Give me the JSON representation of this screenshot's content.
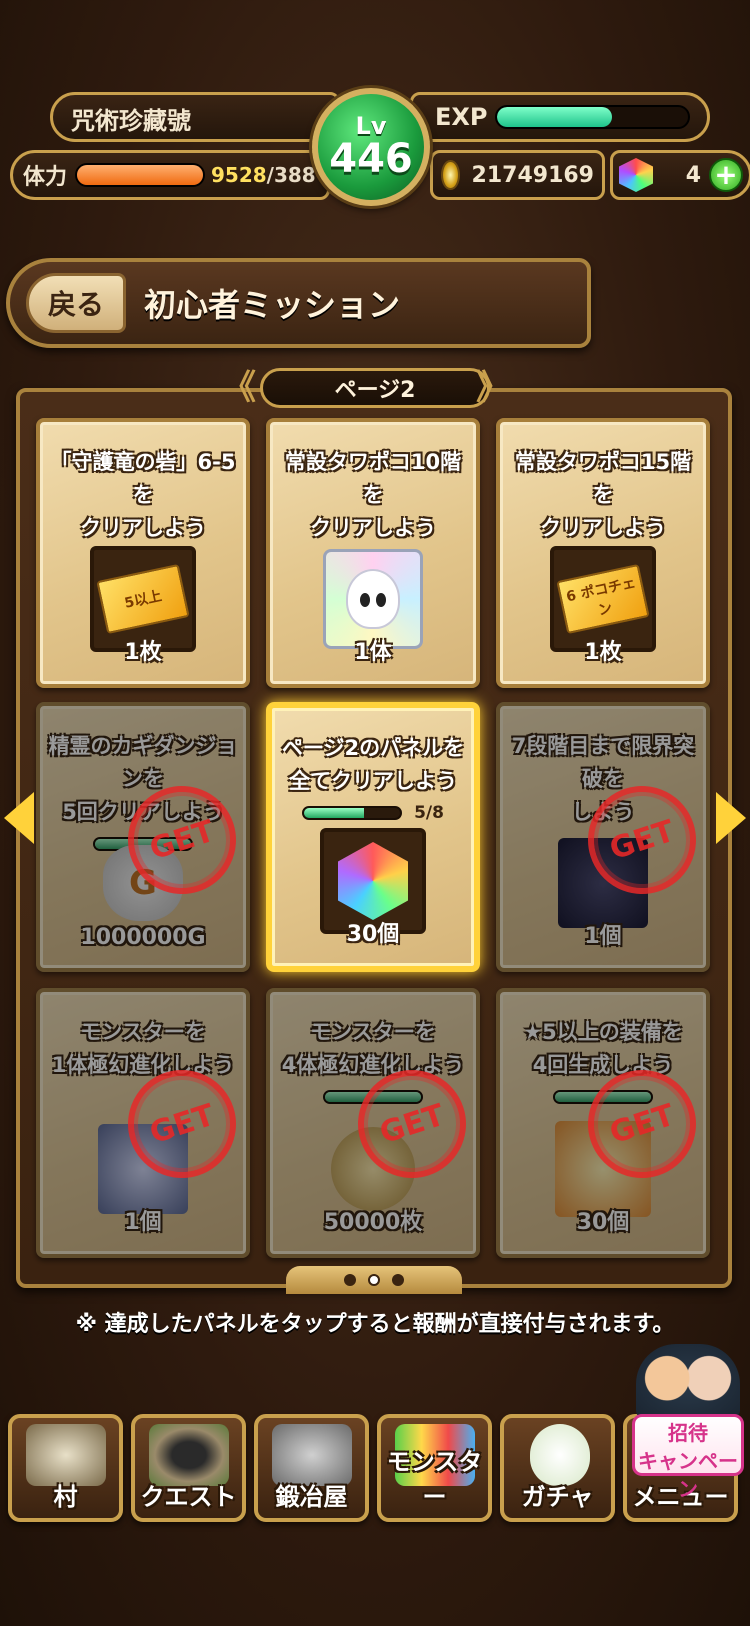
{
  "status": {
    "player_name": "咒術珍藏號",
    "level_label": "Lv",
    "level": "446",
    "exp_label": "EXP",
    "exp_progress": 0.6,
    "stamina_label": "体力",
    "stamina_current": "9528",
    "stamina_max": "/388",
    "stamina_progress": 1.0,
    "gold": "21749169",
    "orbs": "4",
    "plus_label": "+"
  },
  "header": {
    "back_label": "戻る",
    "title": "初心者ミッション"
  },
  "board": {
    "page_label": "ページ2",
    "panels": [
      {
        "title": "「守護竜の砦」6-5を\nクリアしよう",
        "reward_count": "1枚",
        "ticket_text": "5以上"
      },
      {
        "title": "常設タワポコ10階を\nクリアしよう",
        "reward_count": "1体"
      },
      {
        "title": "常設タワポコ15階を\nクリアしよう",
        "reward_count": "1枚",
        "ticket_text": "6 ポコチェン"
      },
      {
        "title": "精霊のカギダンジョンを\n5回クリアしよう",
        "reward_count": "1000000G",
        "bag_text": "G"
      },
      {
        "title": "ページ2のパネルを\n全てクリアしよう",
        "reward_count": "30個",
        "progress_text": "5/8",
        "progress": 0.625
      },
      {
        "title": "7段階目まで限界突破を\nしよう",
        "reward_count": "1個"
      },
      {
        "title": "モンスターを\n1体極幻進化しよう",
        "reward_count": "1個"
      },
      {
        "title": "モンスターを\n4体極幻進化しよう",
        "reward_count": "50000枚"
      },
      {
        "title": "★5以上の装備を\n4回生成しよう",
        "reward_count": "30個"
      }
    ],
    "stamp_text": "GET"
  },
  "note": "※ 達成したパネルをタップすると報酬が直接付与されます。",
  "campaign": {
    "label": "招待\nキャンペーン"
  },
  "bottom_nav": {
    "items": [
      {
        "label": "村"
      },
      {
        "label": "クエスト"
      },
      {
        "label": "鍛冶屋"
      },
      {
        "label": "モンスター"
      },
      {
        "label": "ガチャ"
      },
      {
        "label": "メニュー"
      }
    ]
  },
  "colors": {
    "accent_gold": "#c9a04d",
    "exp_green": "#1ec28a",
    "stamina_orange": "#f06a10",
    "stamp_red": "#e62828"
  }
}
